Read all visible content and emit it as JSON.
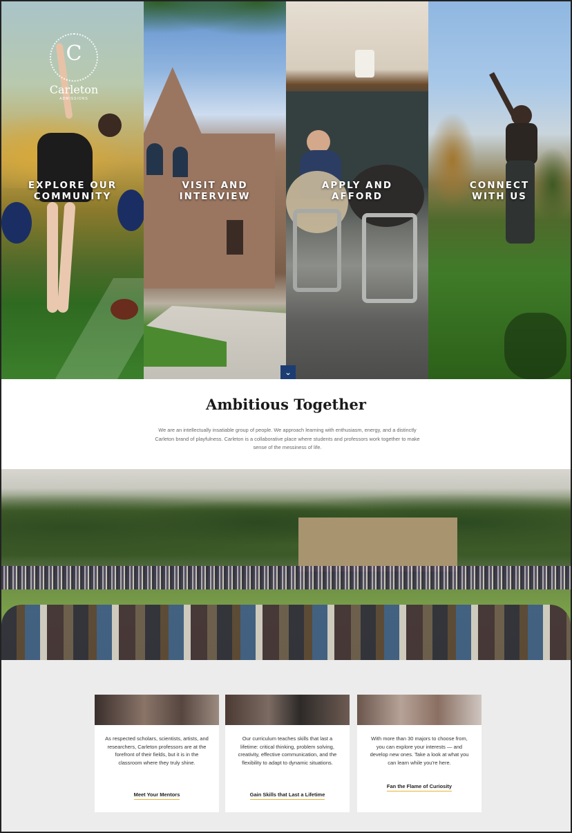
{
  "brand": {
    "logo_letter": "C",
    "name": "Carleton",
    "subtitle": "ADMISSIONS"
  },
  "hero": {
    "panels": [
      {
        "label": "EXPLORE OUR COMMUNITY"
      },
      {
        "label": "VISIT AND INTERVIEW"
      },
      {
        "label": "APPLY AND AFFORD"
      },
      {
        "label": "CONNECT WITH US"
      }
    ],
    "scroll_icon": "chevron-down-icon"
  },
  "intro": {
    "title": "Ambitious Together",
    "body": "We are an intellectually insatiable group of people. We approach learning with enthusiasm, energy, and a distinctly Carleton brand of playfulness. Carleton is a collaborative place where students and professors work together to make sense of the messiness of life."
  },
  "cards": [
    {
      "text": "As respected scholars, scientists, artists, and researchers, Carleton professors are at the forefront of their fields, but it is in the classroom where they truly shine.",
      "link": "Meet Your Mentors"
    },
    {
      "text": "Our curriculum teaches skills that last a lifetime: critical thinking, problem solving, creativity, effective communication, and the flexibility to adapt to dynamic situations.",
      "link": "Gain Skills that Last a Lifetime"
    },
    {
      "text": "With more than 30 majors to choose from, you can explore your interests — and develop new ones. Take a look at what you can learn while you're here.",
      "link": "Fan the Flame of Curiosity"
    }
  ],
  "colors": {
    "accent_navy": "#1b3d73",
    "link_underline": "#e8b230"
  }
}
